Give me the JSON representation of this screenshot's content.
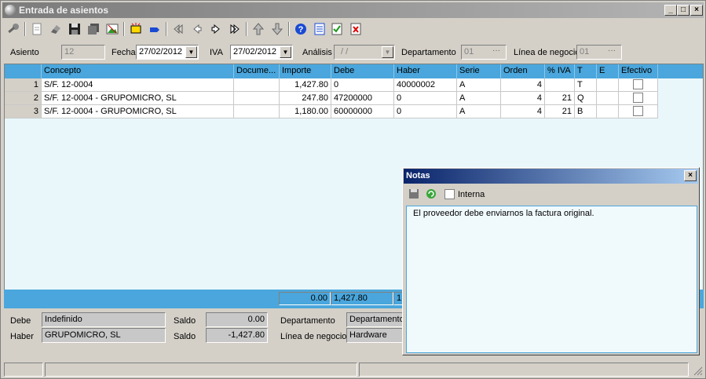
{
  "window": {
    "title": "Entrada de asientos"
  },
  "titlebar_buttons": {
    "minimize": "_",
    "maximize": "□",
    "close": "×"
  },
  "form": {
    "asiento_label": "Asiento",
    "asiento_value": "12",
    "fecha_label": "Fecha",
    "fecha_value": "27/02/2012",
    "iva_label": "IVA",
    "iva_value": "27/02/2012",
    "analisis_label": "Análisis",
    "analisis_value": "/ /",
    "departamento_label": "Departamento",
    "departamento_value": "01",
    "linea_label": "Línea de negocio",
    "linea_value": "01"
  },
  "grid": {
    "columns": [
      "Concepto",
      "Docume...",
      "Importe",
      "Debe",
      "Haber",
      "Serie",
      "Orden",
      "% IVA",
      "T",
      "E",
      "Efectivo"
    ],
    "rows": [
      {
        "n": "1",
        "concepto": "S/F. 12-0004",
        "documento": "",
        "importe": "1,427.80",
        "debe": "0",
        "haber": "40000002",
        "serie": "A",
        "orden": "4",
        "iva": "",
        "t": "T",
        "e": ""
      },
      {
        "n": "2",
        "concepto": "S/F. 12-0004 - GRUPOMICRO, SL",
        "documento": "",
        "importe": "247.80",
        "debe": "47200000",
        "haber": "0",
        "serie": "A",
        "orden": "4",
        "iva": "21",
        "t": "Q",
        "e": ""
      },
      {
        "n": "3",
        "concepto": "S/F. 12-0004 - GRUPOMICRO, SL",
        "documento": "",
        "importe": "1,180.00",
        "debe": "60000000",
        "haber": "0",
        "serie": "A",
        "orden": "4",
        "iva": "21",
        "t": "B",
        "e": ""
      }
    ]
  },
  "totals": {
    "importe": "0.00",
    "debe": "1,427.80",
    "haber": "1"
  },
  "bottom": {
    "debe_label": "Debe",
    "debe_value": "Indefinido",
    "haber_label": "Haber",
    "haber_value": "GRUPOMICRO, SL",
    "saldo_label": "Saldo",
    "saldo_debe": "0.00",
    "saldo_haber": "-1,427.80",
    "departamento_label": "Departamento",
    "departamento_value": "Departamento",
    "linea_label": "Línea de negocio",
    "linea_value": "Hardware"
  },
  "notes": {
    "title": "Notas",
    "interna_label": "Interna",
    "text": "El proveedor debe enviarnos la factura original."
  },
  "icons": [
    "key-icon",
    "document-icon",
    "eraser-icon",
    "save-icon",
    "disks-icon",
    "image-icon",
    "new-entry-icon",
    "label-icon",
    "first-icon",
    "previous-icon",
    "next-icon",
    "last-icon",
    "move-up-icon",
    "move-down-icon",
    "help-icon",
    "notes-icon",
    "validate-icon",
    "delete-icon"
  ]
}
